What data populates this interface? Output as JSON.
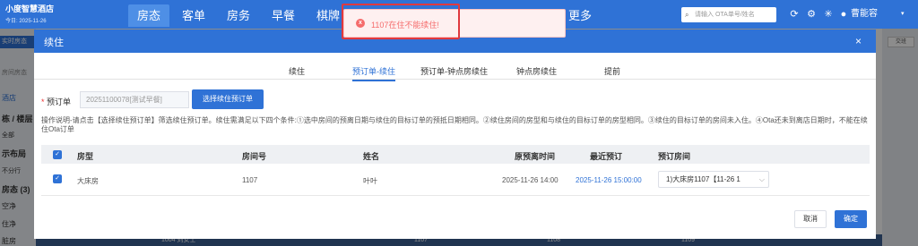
{
  "app": {
    "hotel_name": "小度智慧酒店",
    "date_label": "今日: 2025-11-26",
    "nav_tabs": [
      "房态",
      "客单",
      "房务",
      "早餐",
      "棋牌",
      "更多"
    ],
    "search_placeholder": "请输入 OTA单号/姓名",
    "user_name": "曹能容"
  },
  "sidebar": {
    "btn": "实时房态",
    "items": [
      "房间房态",
      "酒店",
      "栋 / 楼层",
      "全部",
      "示布局",
      "不分行",
      "房态 (3)",
      "空净",
      "住净",
      "脏房"
    ]
  },
  "right_panel": {
    "btn": "交班"
  },
  "bottom_strip": [
    "1004 刘女士",
    "1107",
    "1108",
    "1109"
  ],
  "modal": {
    "title": "续住",
    "close": "×",
    "tabs": [
      "续住",
      "预订单-续住",
      "预订单-钟点房续住",
      "钟点房续住",
      "提前"
    ],
    "active_tab": "预订单-续住",
    "order_label": "预订单",
    "order_input_value": "20251100078[测试早餐]",
    "select_order_btn": "选择续住预订单",
    "instruction": "操作说明-请点击【选择续住预订单】筛选续住预订单。续住需满足以下四个条件:①选中房间的预离日期与续住的目标订单的预抵日期相同。②续住房间的房型和与续住的目标订单的房型相同。③续住的目标订单的房间未入住。④Ota还未到离店日期时，不能在续住Ota订单",
    "table": {
      "headers": [
        "房型",
        "房间号",
        "姓名",
        "原预离时间",
        "最近预订",
        "预订房间"
      ],
      "rows": [
        {
          "room_type": "大床房",
          "room_no": "1107",
          "name": "叶叶",
          "orig_departure": "2025-11-26 14:00",
          "recent_booking": "2025-11-26 15:00:00",
          "booking_room": "1)大床房1107【11-26 1"
        }
      ]
    },
    "cancel_btn": "取消",
    "confirm_btn": "确定"
  },
  "toast": {
    "icon": "x",
    "message": "1107在住不能续住!"
  },
  "colors": {
    "primary": "#2f72d6",
    "error": "#f56c6c",
    "highlight": "#e0393e"
  }
}
